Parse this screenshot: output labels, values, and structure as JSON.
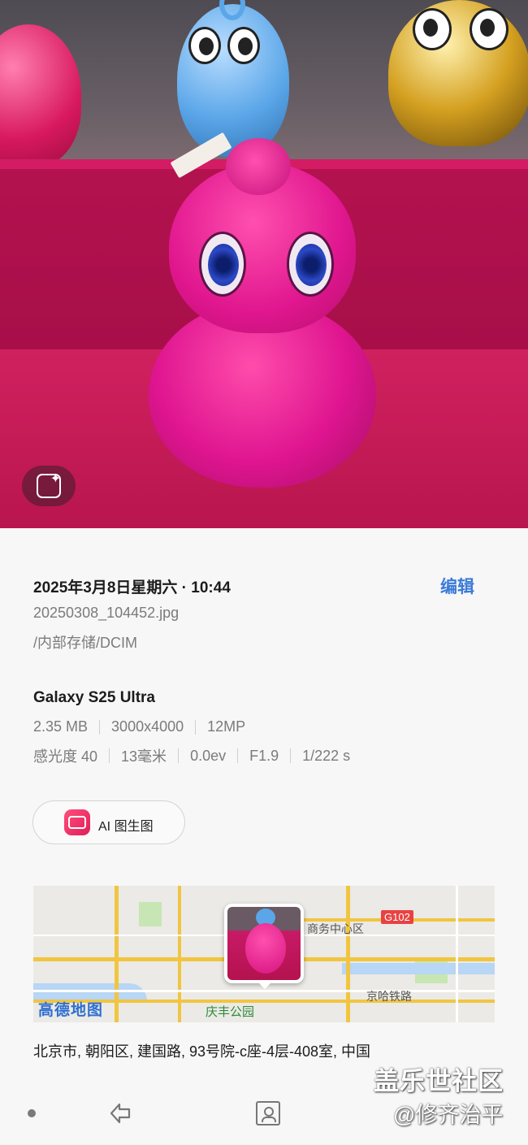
{
  "photo": {
    "ai_edit_icon": "sparkle-edit-icon"
  },
  "details": {
    "date": "2025年3月8日星期六 · 10:44",
    "edit_label": "编辑",
    "filename": "20250308_104452.jpg",
    "path": "/内部存储/DCIM"
  },
  "camera": {
    "device": "Galaxy S25 Ultra",
    "row1": [
      "2.35 MB",
      "3000x4000",
      "12MP"
    ],
    "row2": [
      "感光度 40",
      "13毫米",
      "0.0ev",
      "F1.9",
      "1/222 s"
    ]
  },
  "ai_chip": {
    "label": "AI 图生图"
  },
  "map": {
    "brand": "高德地图",
    "road_label": "G102",
    "labels": {
      "cbd": "商务中心区",
      "railway": "京哈铁路",
      "park": "庆丰公园"
    }
  },
  "address": "北京市, 朝阳区, 建国路, 93号院-c座-4层-408室, 中国",
  "watermark": {
    "line1": "盖乐世社区",
    "line2": "@修齐治平"
  },
  "colors": {
    "accent": "#3b7ad9",
    "background": "#f7f7f7"
  },
  "nav_icons": [
    "recents-dot-icon",
    "back-icon",
    "contact-icon"
  ]
}
